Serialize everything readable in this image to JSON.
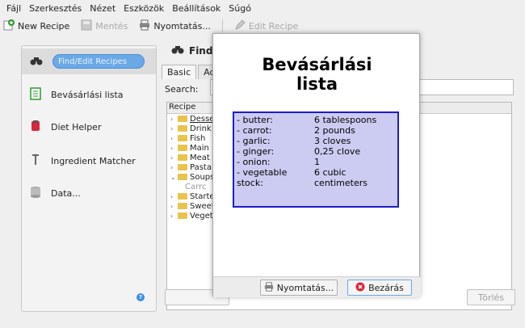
{
  "menubar": [
    "Fájl",
    "Szerkesztés",
    "Nézet",
    "Eszközök",
    "Beállítások",
    "Súgó"
  ],
  "toolbar": {
    "new_recipe": "New Recipe",
    "save": "Mentés",
    "print": "Nyomtatás...",
    "edit_recipe": "Edit Recipe"
  },
  "sidebar": {
    "search_placeholder": "Find/Edit Recipes",
    "items": [
      {
        "label": "Bevásárlási lista",
        "icon": "list-icon"
      },
      {
        "label": "Diet Helper",
        "icon": "diet-icon"
      },
      {
        "label": "Ingredient Matcher",
        "icon": "matcher-icon"
      },
      {
        "label": "Data...",
        "icon": "data-icon"
      }
    ]
  },
  "main": {
    "title": "Find",
    "tabs": [
      "Basic",
      "Ad"
    ],
    "search_label": "Search:",
    "column_header": "Recipe",
    "tree": [
      {
        "label": "Desse",
        "expanded": false
      },
      {
        "label": "Drink",
        "expanded": false
      },
      {
        "label": "Fish",
        "expanded": false
      },
      {
        "label": "Main",
        "expanded": false
      },
      {
        "label": "Meat",
        "expanded": false
      },
      {
        "label": "Pasta",
        "expanded": false
      },
      {
        "label": "Soups",
        "expanded": true
      },
      {
        "label": "Carrc",
        "child": true
      },
      {
        "label": "Starte",
        "expanded": false
      },
      {
        "label": "Sweet",
        "expanded": false
      },
      {
        "label": "Veget",
        "expanded": false
      }
    ],
    "delete_button": "Törlés"
  },
  "dialog": {
    "title": "Bevásárlási lista",
    "items": [
      {
        "name": "- butter:",
        "qty": "6 tablespoons"
      },
      {
        "name": "- carrot:",
        "qty": "2 pounds"
      },
      {
        "name": "- garlic:",
        "qty": "3 cloves"
      },
      {
        "name": "- ginger:",
        "qty": "0,25 clove"
      },
      {
        "name": "- onion:",
        "qty": "1"
      },
      {
        "name": "- vegetable stock:",
        "qty": "6 cubic centimeters"
      }
    ],
    "print_button": "Nyomtatás...",
    "close_button": "Bezárás"
  },
  "colors": {
    "accent": "#4a90d9",
    "table_border": "#1c1ccf",
    "table_bg": "#ccccf2"
  }
}
